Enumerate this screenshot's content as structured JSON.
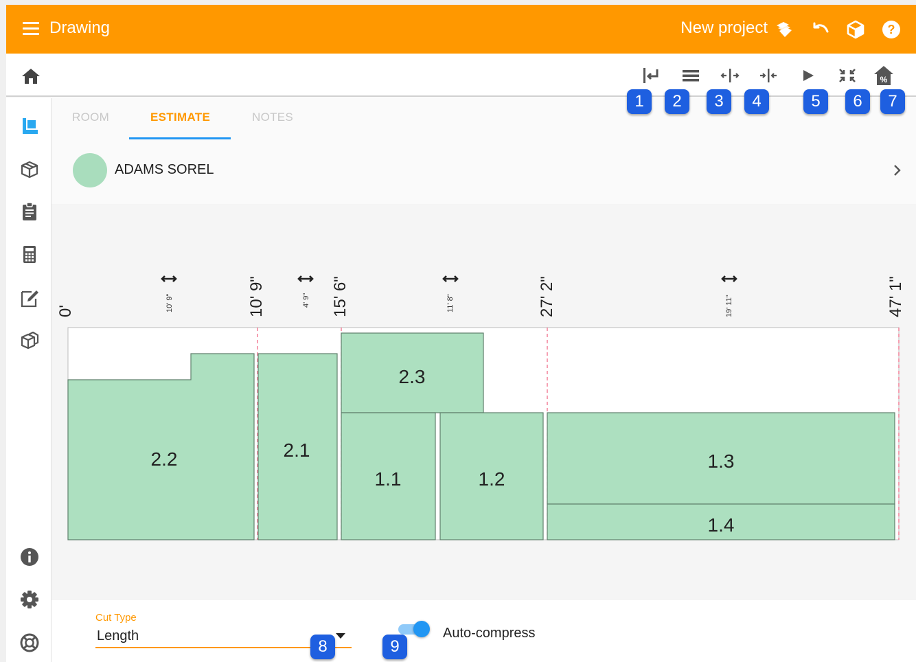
{
  "app": {
    "title": "Drawing",
    "project": "New project"
  },
  "tabs": [
    {
      "label": "ROOM"
    },
    {
      "label": "ESTIMATE"
    },
    {
      "label": "NOTES"
    }
  ],
  "customer": {
    "name": "ADAMS SOREL",
    "color": "#a9ddbd"
  },
  "badges": [
    "1",
    "2",
    "3",
    "4",
    "5",
    "6",
    "7",
    "8",
    "9"
  ],
  "icons": {
    "menu": "menu-icon",
    "topbar": [
      "layers-icon",
      "undo-icon",
      "cube-icon",
      "help-icon"
    ],
    "toolbar": [
      "cut-return-icon",
      "lines-icon",
      "split-icon",
      "join-icon",
      "play-icon",
      "compress-icon",
      "house-percent-icon"
    ],
    "sidebar": [
      "drawing-icon",
      "box-icon",
      "clipboard-icon",
      "calculator-icon",
      "edit-icon",
      "package-icon",
      "info-icon",
      "settings-icon",
      "support-icon"
    ]
  },
  "colors": {
    "accent": "#ff9800",
    "primary": "#2196f3",
    "piece": "#ade0c0",
    "badge": "#1e5fe0"
  },
  "diagram": {
    "ruler": [
      {
        "label": "0'",
        "value": 0
      },
      {
        "label": "10' 9\"",
        "value": 129
      },
      {
        "label": "15' 6\"",
        "value": 186
      },
      {
        "label": "27' 2\"",
        "value": 326
      },
      {
        "label": "47' 1\"",
        "value": 565
      }
    ],
    "spans": [
      "10' 9\"",
      "4' 9\"",
      "11' 8\"",
      "19' 11\""
    ],
    "pieces": [
      "2.2",
      "2.1",
      "2.3",
      "1.1",
      "1.2",
      "1.3",
      "1.4"
    ]
  },
  "cut_type": {
    "label": "Cut Type",
    "value": "Length"
  },
  "auto_compress": {
    "label": "Auto-compress",
    "enabled": true
  }
}
